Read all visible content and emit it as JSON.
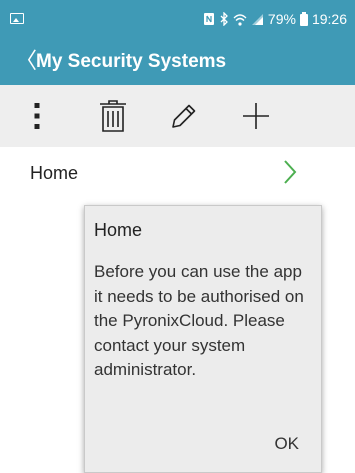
{
  "status_bar": {
    "battery_percent": "79%",
    "time": "19:26",
    "icons": [
      "image-icon",
      "nfc-icon",
      "bluetooth-icon",
      "wifi-icon",
      "signal-icon",
      "battery-icon"
    ]
  },
  "app_bar": {
    "back_glyph": "〈",
    "title": "My Security Systems"
  },
  "toolbar": {
    "icons": [
      "more-vert-icon",
      "trash-icon",
      "pencil-icon",
      "plus-icon"
    ]
  },
  "list": {
    "items": [
      {
        "label": "Home",
        "icon": "chevron-right-icon"
      }
    ]
  },
  "dialog": {
    "title": "Home",
    "message": "Before you can use the app it needs to be authorised on the PyronixCloud. Please contact your system administrator.",
    "ok_label": "OK"
  },
  "colors": {
    "app_bar": "#3f9ab6",
    "toolbar": "#eeeeee",
    "chevron": "#4caf50",
    "dialog_bg": "#ececec"
  }
}
